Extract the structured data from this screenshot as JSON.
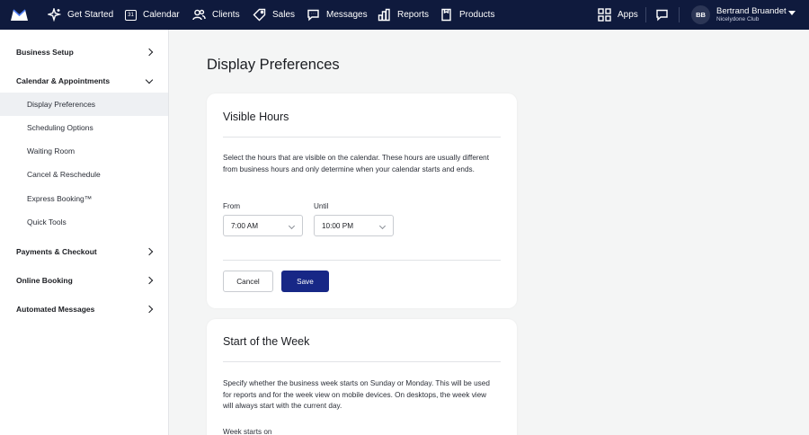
{
  "nav": {
    "items": [
      {
        "label": "Get Started",
        "icon": "sparkle-icon"
      },
      {
        "label": "Calendar",
        "icon": "calendar-icon"
      },
      {
        "label": "Clients",
        "icon": "clients-icon"
      },
      {
        "label": "Sales",
        "icon": "tag-icon"
      },
      {
        "label": "Messages",
        "icon": "chat-icon"
      },
      {
        "label": "Reports",
        "icon": "chart-icon"
      },
      {
        "label": "Products",
        "icon": "box-icon"
      }
    ],
    "calendar_day": "31",
    "apps_label": "Apps",
    "user": {
      "initials": "BB",
      "name": "Bertrand Bruandet",
      "business": "Nicelydone Club"
    }
  },
  "sidebar": {
    "sections": [
      {
        "label": "Business Setup"
      },
      {
        "label": "Calendar & Appointments"
      },
      {
        "label": "Payments & Checkout"
      },
      {
        "label": "Online Booking"
      },
      {
        "label": "Automated Messages"
      }
    ],
    "sub_items": [
      {
        "label": "Display Preferences"
      },
      {
        "label": "Scheduling Options"
      },
      {
        "label": "Waiting Room"
      },
      {
        "label": "Cancel & Reschedule"
      },
      {
        "label": "Express Booking™"
      },
      {
        "label": "Quick Tools"
      }
    ]
  },
  "page": {
    "title": "Display Preferences",
    "visible_hours": {
      "title": "Visible Hours",
      "description": "Select the hours that are visible on the calendar. These hours are usually different from business hours and only determine when your calendar starts and ends.",
      "from_label": "From",
      "from_value": "7:00 AM",
      "until_label": "Until",
      "until_value": "10:00 PM",
      "cancel_label": "Cancel",
      "save_label": "Save"
    },
    "week_start": {
      "title": "Start of the Week",
      "description": "Specify whether the business week starts on Sunday or Monday. This will be used for reports and for the week view on mobile devices. On desktops, the week view will always start with the current day.",
      "field_label": "Week starts on"
    }
  },
  "colors": {
    "nav_bg": "#0f1a3d",
    "accent": "#172786",
    "page_bg": "#f4f5f5"
  }
}
